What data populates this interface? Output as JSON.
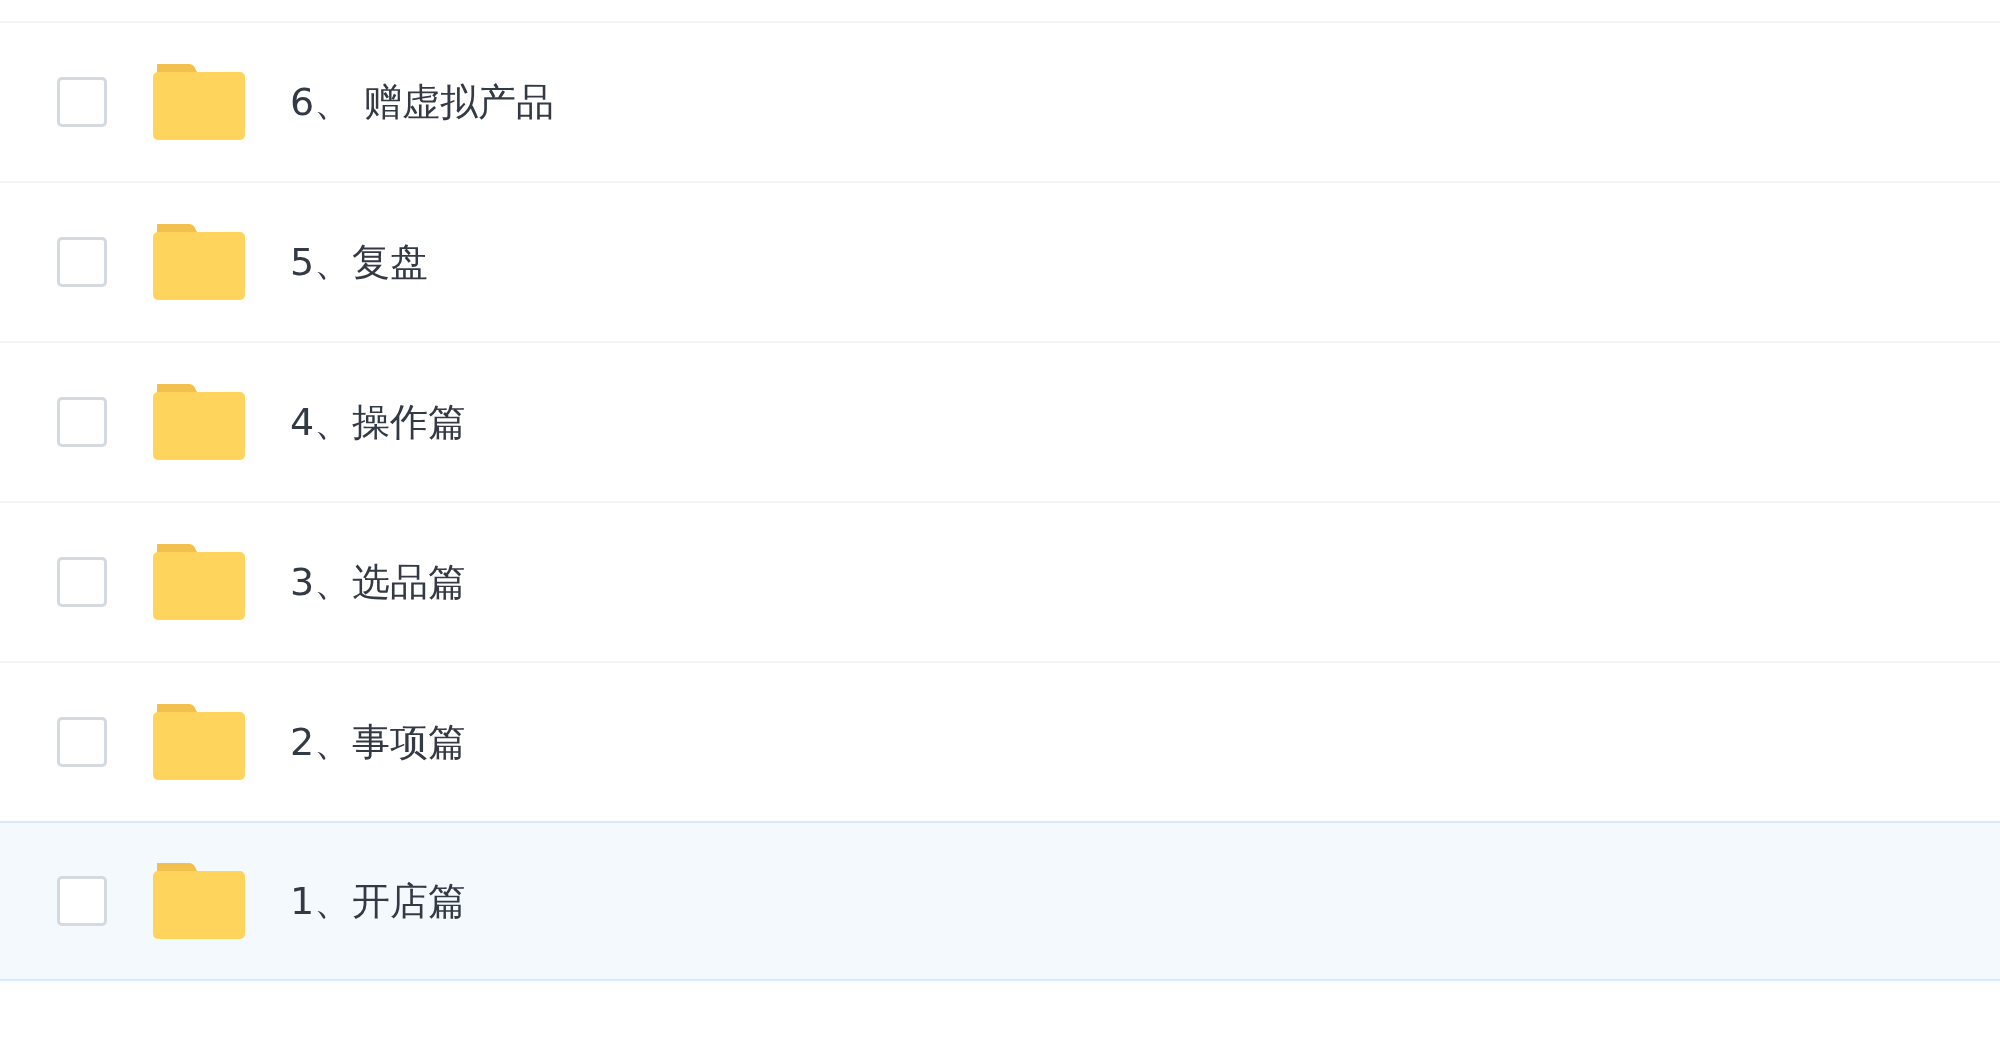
{
  "rows": [
    {
      "name": "6、 赠虚拟产品",
      "checked": false,
      "highlighted": false
    },
    {
      "name": "5、复盘",
      "checked": false,
      "highlighted": false
    },
    {
      "name": "4、操作篇",
      "checked": false,
      "highlighted": false
    },
    {
      "name": "3、选品篇",
      "checked": false,
      "highlighted": false
    },
    {
      "name": "2、事项篇",
      "checked": false,
      "highlighted": false
    },
    {
      "name": "1、开店篇",
      "checked": false,
      "highlighted": true
    }
  ]
}
